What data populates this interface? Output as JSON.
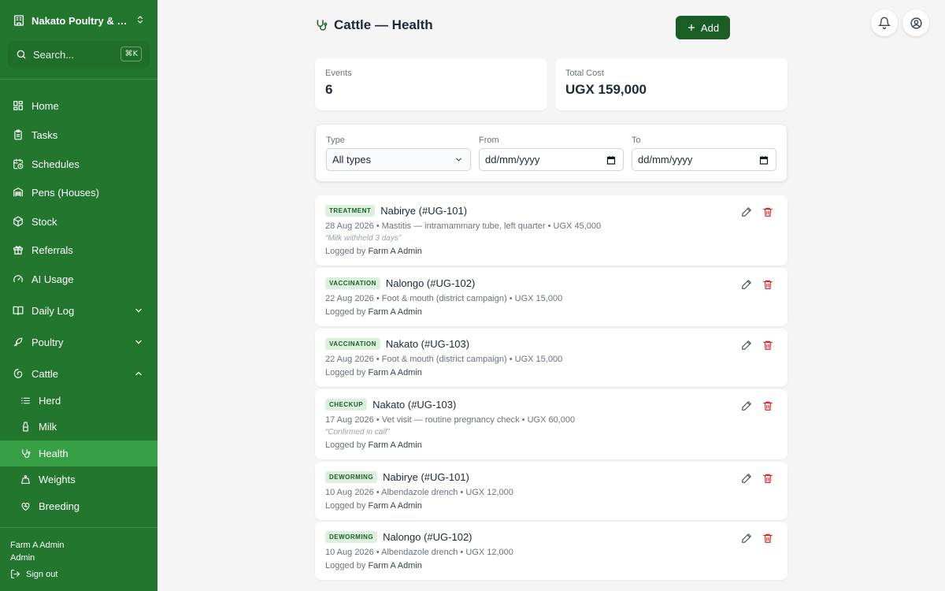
{
  "sidebar": {
    "farm_name": "Nakato Poultry & Da...",
    "search_placeholder": "Search...",
    "search_shortcut": "⌘K",
    "nav": {
      "home": "Home",
      "tasks": "Tasks",
      "schedules": "Schedules",
      "pens": "Pens (Houses)",
      "stock": "Stock",
      "referrals": "Referrals",
      "ai_usage": "AI Usage",
      "daily_log": "Daily Log",
      "poultry": "Poultry",
      "cattle": "Cattle"
    },
    "cattle_sub": {
      "herd": "Herd",
      "milk": "Milk",
      "health": "Health",
      "weights": "Weights",
      "breeding": "Breeding"
    },
    "user_name": "Farm A Admin",
    "user_role": "Admin",
    "sign_out": "Sign out"
  },
  "header": {
    "title": "Cattle — Health",
    "add_label": "Add"
  },
  "stats": {
    "events_label": "Events",
    "events_value": "6",
    "cost_label": "Total Cost",
    "cost_value": "UGX 159,000"
  },
  "filters": {
    "type_label": "Type",
    "type_value": "All types",
    "from_label": "From",
    "from_placeholder": "dd/mm/yyyy",
    "to_label": "To",
    "to_placeholder": "dd/mm/yyyy"
  },
  "events": [
    {
      "type": "TREATMENT",
      "animal": "Nabirye (#UG-101)",
      "detail": "28 Aug 2026 • Mastitis — intramammary tube, left quarter • UGX 45,000",
      "note": "“Milk withheld 3 days”",
      "logged_prefix": "Logged by ",
      "logged_by": "Farm A Admin"
    },
    {
      "type": "VACCINATION",
      "animal": "Nalongo (#UG-102)",
      "detail": "22 Aug 2026 • Foot & mouth (district campaign) • UGX 15,000",
      "note": "",
      "logged_prefix": "Logged by ",
      "logged_by": "Farm A Admin"
    },
    {
      "type": "VACCINATION",
      "animal": "Nakato (#UG-103)",
      "detail": "22 Aug 2026 • Foot & mouth (district campaign) • UGX 15,000",
      "note": "",
      "logged_prefix": "Logged by ",
      "logged_by": "Farm A Admin"
    },
    {
      "type": "CHECKUP",
      "animal": "Nakato (#UG-103)",
      "detail": "17 Aug 2026 • Vet visit — routine pregnancy check • UGX 60,000",
      "note": "“Confirmed in calf”",
      "logged_prefix": "Logged by ",
      "logged_by": "Farm A Admin"
    },
    {
      "type": "DEWORMING",
      "animal": "Nabirye (#UG-101)",
      "detail": "10 Aug 2026 • Albendazole drench • UGX 12,000",
      "note": "",
      "logged_prefix": "Logged by ",
      "logged_by": "Farm A Admin"
    },
    {
      "type": "DEWORMING",
      "animal": "Nalongo (#UG-102)",
      "detail": "10 Aug 2026 • Albendazole drench • UGX 12,000",
      "note": "",
      "logged_prefix": "Logged by ",
      "logged_by": "Farm A Admin"
    }
  ],
  "colors": {
    "sidebar_bg": "#22762e",
    "sidebar_active": "#37a047",
    "primary_button": "#1b5e25",
    "badge_bg": "#dcf0dd",
    "delete_red": "#dc2626"
  }
}
